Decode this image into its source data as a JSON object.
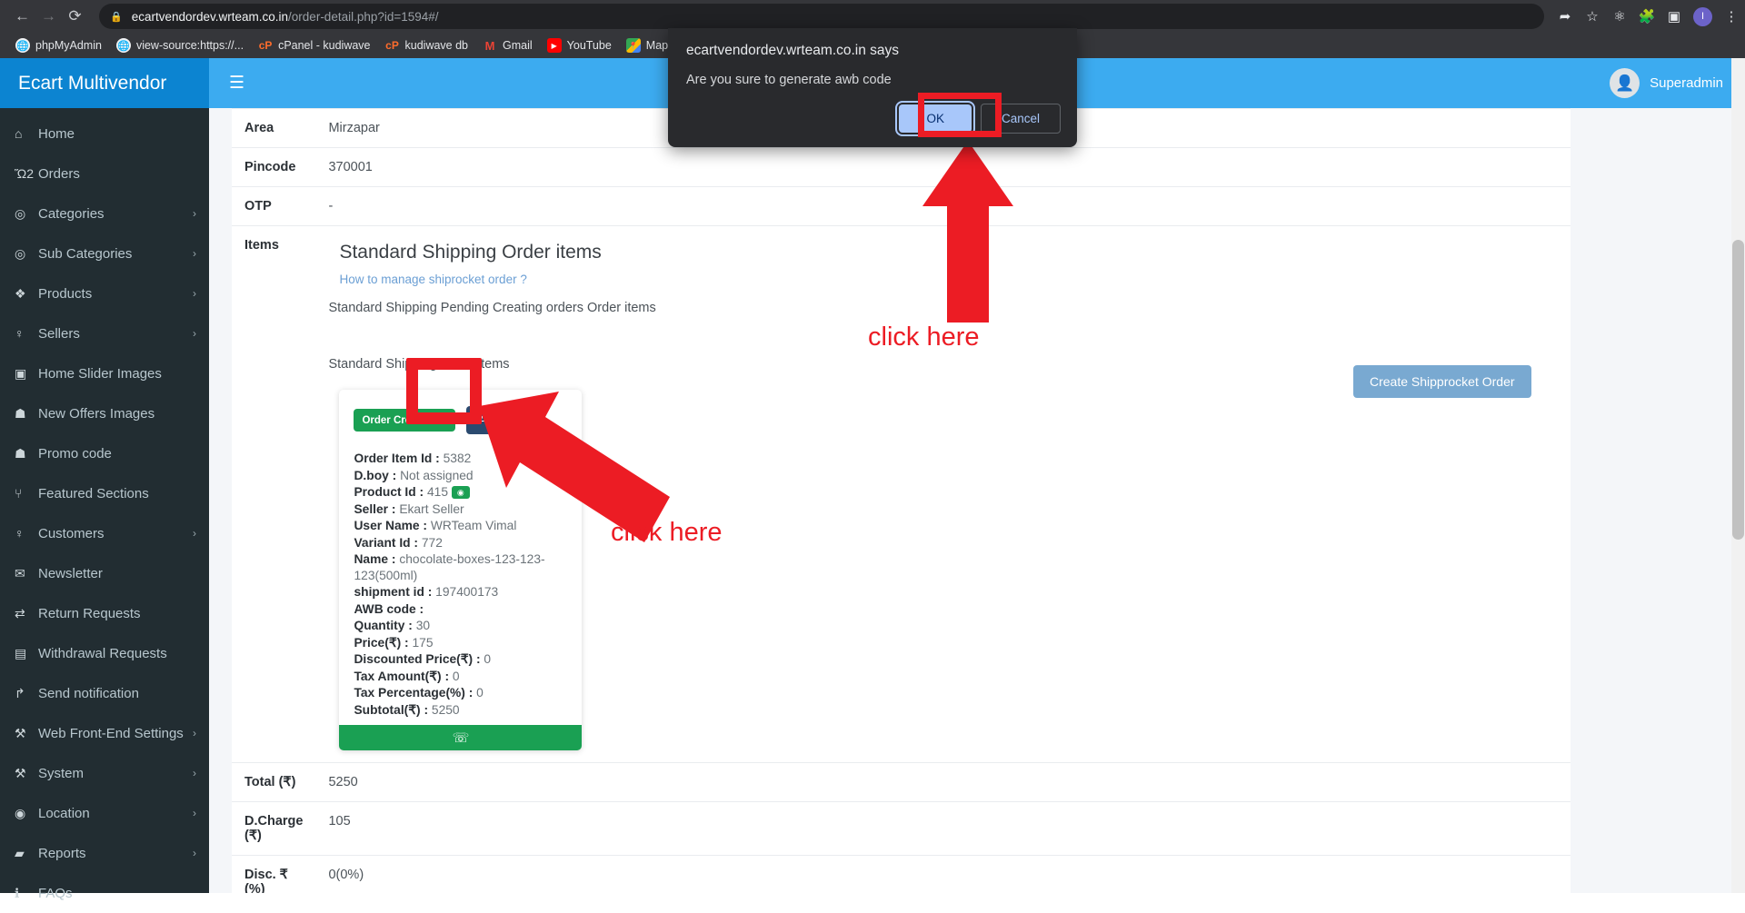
{
  "browser": {
    "back_icon": "arrow-left-icon",
    "forward_icon": "arrow-right-icon",
    "reload_icon": "reload-icon",
    "lock_icon": "lock-icon",
    "url_host": "ecartvendordev.wrteam.co.in",
    "url_path": "/order-detail.php?id=1594#/",
    "toolbar_icons": [
      "share-icon",
      "bookmark-star-icon",
      "extension-react-icon",
      "puzzle-extensions-icon",
      "side-panel-icon",
      "profile-avatar-icon",
      "chrome-menu-icon"
    ],
    "profile_initial": "I",
    "bookmarks": [
      {
        "label": "phpMyAdmin",
        "icon": "globe-icon"
      },
      {
        "label": "view-source:https://...",
        "icon": "globe-icon"
      },
      {
        "label": "cPanel - kudiwave",
        "icon": "cpanel-icon"
      },
      {
        "label": "kudiwave db",
        "icon": "cpanel-icon"
      },
      {
        "label": "Gmail",
        "icon": "gmail-icon"
      },
      {
        "label": "YouTube",
        "icon": "youtube-icon"
      },
      {
        "label": "Maps",
        "icon": "maps-icon"
      }
    ]
  },
  "dialog": {
    "title": "ecartvendordev.wrteam.co.in says",
    "message": "Are you sure to generate awb code",
    "ok_label": "OK",
    "cancel_label": "Cancel"
  },
  "sidebar": {
    "brand": "Ecart Multivendor",
    "items": [
      {
        "label": "Home",
        "icon": "home-icon",
        "glyph": "⌂",
        "arrow": ""
      },
      {
        "label": "Orders",
        "icon": "cart-icon",
        "glyph": "Ὥ2",
        "arrow": ""
      },
      {
        "label": "Categories",
        "icon": "target-icon",
        "glyph": "◎",
        "arrow": "›"
      },
      {
        "label": "Sub Categories",
        "icon": "target-icon",
        "glyph": "◎",
        "arrow": "›"
      },
      {
        "label": "Products",
        "icon": "cubes-icon",
        "glyph": "❖",
        "arrow": "›"
      },
      {
        "label": "Sellers",
        "icon": "person-icon",
        "glyph": "♀",
        "arrow": "›"
      },
      {
        "label": "Home Slider Images",
        "icon": "image-icon",
        "glyph": "▣",
        "arrow": ""
      },
      {
        "label": "New Offers Images",
        "icon": "gift-icon",
        "glyph": "☗",
        "arrow": ""
      },
      {
        "label": "Promo code",
        "icon": "gift-icon",
        "glyph": "☗",
        "arrow": ""
      },
      {
        "label": "Featured Sections",
        "icon": "sitemap-icon",
        "glyph": "⑂",
        "arrow": ""
      },
      {
        "label": "Customers",
        "icon": "person-icon",
        "glyph": "♀",
        "arrow": "›"
      },
      {
        "label": "Newsletter",
        "icon": "envelope-icon",
        "glyph": "✉",
        "arrow": ""
      },
      {
        "label": "Return Requests",
        "icon": "retweet-icon",
        "glyph": "⇄",
        "arrow": ""
      },
      {
        "label": "Withdrawal Requests",
        "icon": "credit-card-icon",
        "glyph": "▤",
        "arrow": ""
      },
      {
        "label": "Send notification",
        "icon": "share-square-icon",
        "glyph": "↱",
        "arrow": ""
      },
      {
        "label": "Web Front-End Settings",
        "icon": "wrench-icon",
        "glyph": "⚒",
        "arrow": "›"
      },
      {
        "label": "System",
        "icon": "wrench-icon",
        "glyph": "⚒",
        "arrow": "›"
      },
      {
        "label": "Location",
        "icon": "map-pin-icon",
        "glyph": "◉",
        "arrow": "›"
      },
      {
        "label": "Reports",
        "icon": "folder-icon",
        "glyph": "▰",
        "arrow": "›"
      },
      {
        "label": "FAQs",
        "icon": "info-icon",
        "glyph": "ℹ",
        "arrow": ""
      }
    ]
  },
  "topbar": {
    "hamburger_icon": "hamburger-menu-icon",
    "user_name": "Superadmin",
    "avatar_icon": "user-avatar-icon"
  },
  "detail_rows": [
    {
      "key": "Area",
      "value": "Mirzapar"
    },
    {
      "key": "Pincode",
      "value": "370001"
    },
    {
      "key": "OTP",
      "value": "-"
    }
  ],
  "items_section": {
    "row_key": "Items",
    "heading": "Standard Shipping Order items",
    "help_link": "How to manage shiprocket order ?",
    "pending_text": "Standard Shipping Pending Creating orders Order items",
    "list_text": "Standard Shipping Order items",
    "create_button": "Create Shipprocket Order"
  },
  "item_card": {
    "status_badge": "Order Created",
    "status_check_icon": "check-square-icon",
    "awb_button": "AWB",
    "eye_icon": "eye-icon",
    "whatsapp_icon": "whatsapp-icon",
    "fields": [
      {
        "label": "Order Item Id :",
        "value": "5382",
        "has_eye": false
      },
      {
        "label": "D.boy :",
        "value": "Not assigned",
        "has_eye": false
      },
      {
        "label": "Product Id :",
        "value": "415",
        "has_eye": true
      },
      {
        "label": "Seller :",
        "value": "Ekart Seller",
        "has_eye": false
      },
      {
        "label": "User Name :",
        "value": "WRTeam Vimal",
        "has_eye": false
      },
      {
        "label": "Variant Id :",
        "value": "772",
        "has_eye": false
      },
      {
        "label": "Name :",
        "value": "chocolate-boxes-123-123-123(500ml)",
        "has_eye": false
      },
      {
        "label": "shipment id :",
        "value": "197400173",
        "has_eye": false
      },
      {
        "label": "AWB code :",
        "value": "",
        "has_eye": false
      },
      {
        "label": "Quantity :",
        "value": "30",
        "has_eye": false
      },
      {
        "label": "Price(₹) :",
        "value": "175",
        "has_eye": false
      },
      {
        "label": "Discounted Price(₹) :",
        "value": "0",
        "has_eye": false
      },
      {
        "label": "Tax Amount(₹) :",
        "value": "0",
        "has_eye": false
      },
      {
        "label": "Tax Percentage(%) :",
        "value": "0",
        "has_eye": false
      },
      {
        "label": "Subtotal(₹) :",
        "value": "5250",
        "has_eye": false
      }
    ]
  },
  "totals_rows": [
    {
      "key": "Total (₹)",
      "value": "5250"
    },
    {
      "key": "D.Charge (₹)",
      "value": "105"
    },
    {
      "key": "Disc. ₹ (%)",
      "value": "0(0%)"
    }
  ],
  "annotations": {
    "up_label": "click here",
    "diagonal_label": "click here",
    "highlight_color": "#ec1c24"
  },
  "colors": {
    "brand_blue": "#0c84d1",
    "header_blue": "#3cabf0",
    "sidebar_dark": "#222d32",
    "success_green": "#1aa053",
    "awb_navy": "#2b4a6f",
    "annotation_red": "#ec1c24"
  }
}
